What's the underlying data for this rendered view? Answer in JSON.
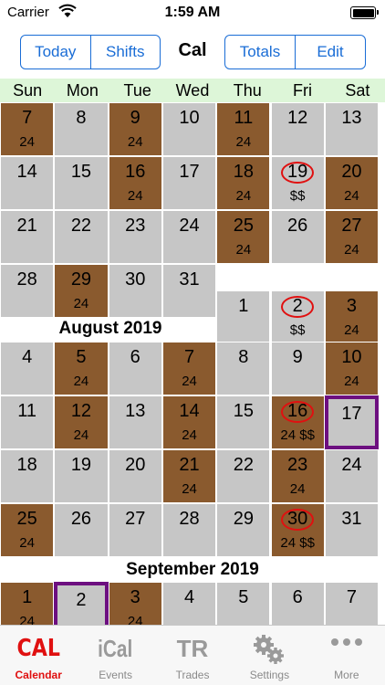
{
  "status": {
    "carrier": "Carrier",
    "time": "1:59 AM"
  },
  "nav": {
    "left_buttons": [
      "Today",
      "Shifts"
    ],
    "title": "Cal",
    "right_buttons": [
      "Totals",
      "Edit"
    ]
  },
  "weekdays": [
    "Sun",
    "Mon",
    "Tue",
    "Wed",
    "Thu",
    "Fri",
    "Sat"
  ],
  "months": [
    {
      "label": "August 2019",
      "days": [
        {
          "d": "7",
          "sub": "24",
          "shift": true
        },
        {
          "d": "8"
        },
        {
          "d": "9",
          "sub": "24",
          "shift": true
        },
        {
          "d": "10"
        },
        {
          "d": "11",
          "sub": "24",
          "shift": true
        },
        {
          "d": "12"
        },
        {
          "d": "13"
        },
        {
          "d": "14"
        },
        {
          "d": "15"
        },
        {
          "d": "16",
          "sub": "24",
          "shift": true
        },
        {
          "d": "17"
        },
        {
          "d": "18",
          "sub": "24",
          "shift": true
        },
        {
          "d": "19",
          "sub": "$$",
          "circle": true
        },
        {
          "d": "20",
          "sub": "24",
          "shift": true
        },
        {
          "d": "21"
        },
        {
          "d": "22"
        },
        {
          "d": "23"
        },
        {
          "d": "24"
        },
        {
          "d": "25",
          "sub": "24",
          "shift": true
        },
        {
          "d": "26"
        },
        {
          "d": "27",
          "sub": "24",
          "shift": true
        },
        {
          "d": "28"
        },
        {
          "d": "29",
          "sub": "24",
          "shift": true
        },
        {
          "d": "30"
        },
        {
          "d": "31"
        }
      ]
    },
    {
      "label": "August 2019",
      "days": [
        {
          "d": "1"
        },
        {
          "d": "2",
          "sub": "$$",
          "circle": true
        },
        {
          "d": "3",
          "sub": "24",
          "shift": true
        },
        {
          "d": "4"
        },
        {
          "d": "5",
          "sub": "24",
          "shift": true
        },
        {
          "d": "6"
        },
        {
          "d": "7",
          "sub": "24",
          "shift": true
        },
        {
          "d": "8"
        },
        {
          "d": "9"
        },
        {
          "d": "10",
          "sub": "24",
          "shift": true
        },
        {
          "d": "11"
        },
        {
          "d": "12",
          "sub": "24",
          "shift": true
        },
        {
          "d": "13"
        },
        {
          "d": "14",
          "sub": "24",
          "shift": true
        },
        {
          "d": "15"
        },
        {
          "d": "16",
          "sub": "24 $$",
          "shift": true,
          "circle": true
        },
        {
          "d": "17",
          "selected": true
        },
        {
          "d": "18"
        },
        {
          "d": "19"
        },
        {
          "d": "20"
        },
        {
          "d": "21",
          "sub": "24",
          "shift": true
        },
        {
          "d": "22"
        },
        {
          "d": "23",
          "sub": "24",
          "shift": true
        },
        {
          "d": "24"
        },
        {
          "d": "25",
          "sub": "24",
          "shift": true
        },
        {
          "d": "26"
        },
        {
          "d": "27"
        },
        {
          "d": "28"
        },
        {
          "d": "29"
        },
        {
          "d": "30",
          "sub": "24 $$",
          "shift": true,
          "circle": true
        },
        {
          "d": "31"
        }
      ]
    },
    {
      "label": "September 2019",
      "days": [
        {
          "d": "1",
          "sub": "24",
          "shift": true
        },
        {
          "d": "2",
          "selected": true
        },
        {
          "d": "3",
          "sub": "24",
          "shift": true
        },
        {
          "d": "4"
        },
        {
          "d": "5"
        },
        {
          "d": "6"
        },
        {
          "d": "7"
        }
      ]
    }
  ],
  "tabs": [
    {
      "label": "Calendar",
      "icon": "CAL",
      "icon_name": "cal-text-icon",
      "active": true
    },
    {
      "label": "Events",
      "icon": "iCal",
      "icon_name": "ical-text-icon"
    },
    {
      "label": "Trades",
      "icon": "TR",
      "icon_name": "tr-text-icon"
    },
    {
      "label": "Settings",
      "icon_name": "gears-icon"
    },
    {
      "label": "More",
      "icon_name": "ellipsis-icon"
    }
  ],
  "colors": {
    "accent": "#1a6dd6",
    "shift": "#8a5a2e",
    "empty_day": "#c6c6c6",
    "weekday_bg": "#ddf6d8",
    "pay_circle": "#e01010",
    "selected_border": "#6d0f80",
    "active_tab": "#e01010"
  }
}
